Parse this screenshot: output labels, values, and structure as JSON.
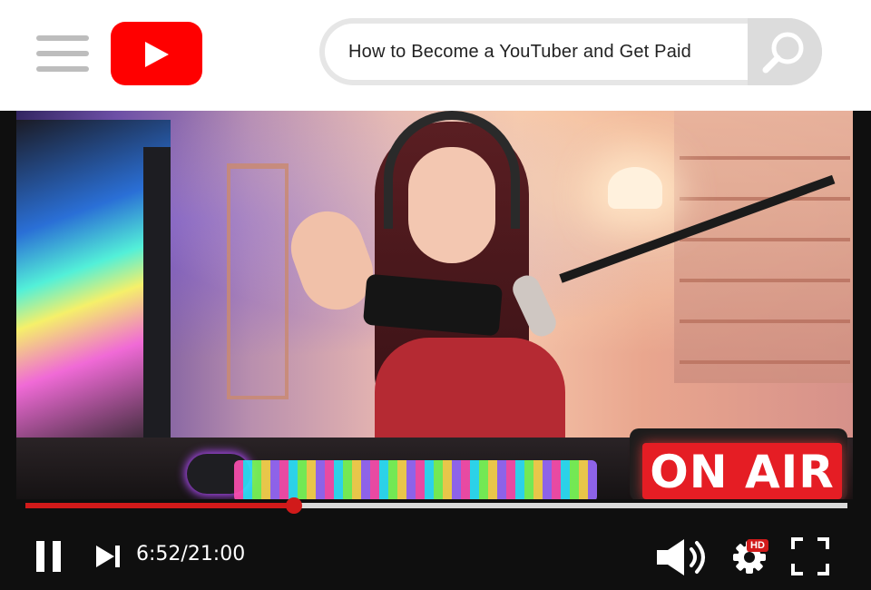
{
  "search": {
    "query": "How to Become a YouTuber and Get Paid"
  },
  "player": {
    "current_time": "6:52",
    "duration": "21:00",
    "time_display": "6:52/21:00",
    "progress_fraction": 0.327,
    "quality_badge": "HD",
    "on_air_sign": "ON AIR"
  },
  "icons": {
    "menu": "hamburger-menu-icon",
    "logo": "youtube-play-logo",
    "search": "magnifier-icon",
    "pause": "pause-icon",
    "next": "skip-next-icon",
    "volume": "volume-icon",
    "settings": "gear-icon",
    "fullscreen": "fullscreen-icon"
  },
  "colors": {
    "brand_red": "#ff0000",
    "progress_red": "#d11a1a",
    "player_bg": "#0f0f0f"
  }
}
